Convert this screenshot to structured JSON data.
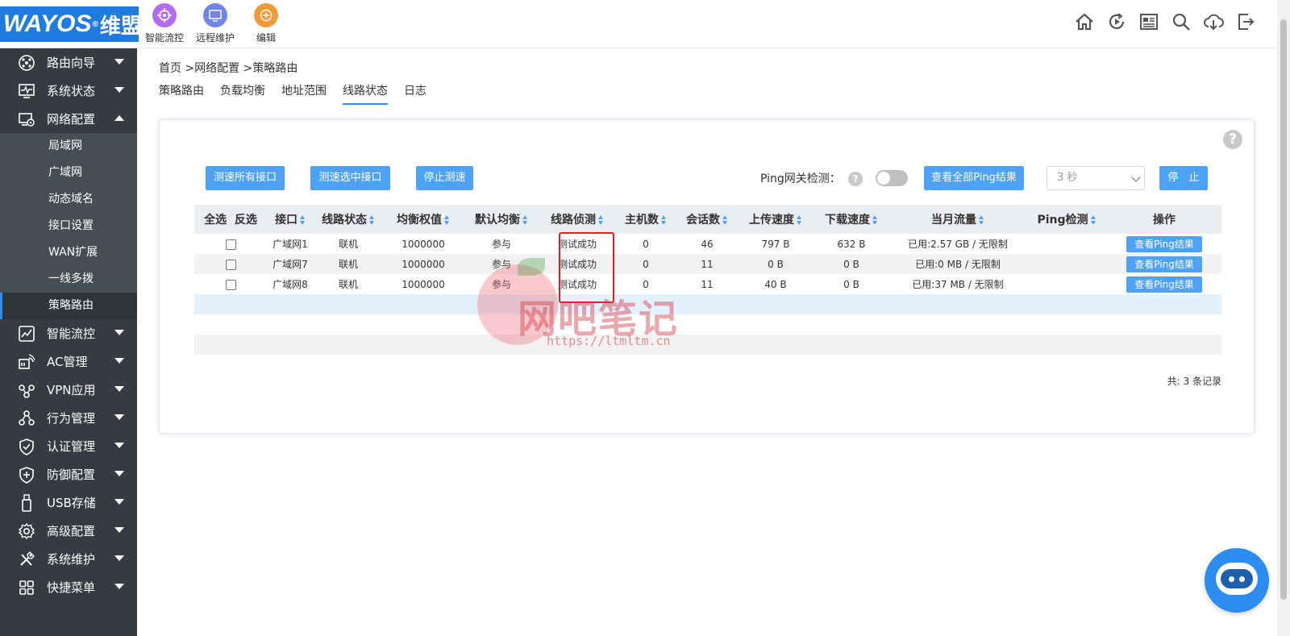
{
  "header": {
    "logo_text": "WAYOS",
    "logo_reg": "®",
    "logo_cn": "维盟",
    "quick_items": [
      {
        "label": "智能流控",
        "color": "#b46bf0",
        "icon": "target-icon"
      },
      {
        "label": "远程维护",
        "color": "#6f86e8",
        "icon": "monitor-icon"
      },
      {
        "label": "编辑",
        "color": "#f29a3a",
        "icon": "plus-circle-icon"
      }
    ],
    "toolbar_icons": [
      "home-icon",
      "refresh-play-icon",
      "news-icon",
      "search-icon",
      "cloud-download-icon",
      "logout-icon"
    ]
  },
  "sidebar": {
    "items": [
      {
        "label": "路由向导",
        "icon": "wizard-icon"
      },
      {
        "label": "系统状态",
        "icon": "monitor-pulse-icon"
      },
      {
        "label": "网络配置",
        "icon": "network-config-icon",
        "expanded": true
      },
      {
        "label": "智能流控",
        "icon": "chart-icon"
      },
      {
        "label": "AC管理",
        "icon": "wifi-icon"
      },
      {
        "label": "VPN应用",
        "icon": "vpn-icon"
      },
      {
        "label": "行为管理",
        "icon": "behavior-icon"
      },
      {
        "label": "认证管理",
        "icon": "shield-check-icon"
      },
      {
        "label": "防御配置",
        "icon": "shield-plus-icon"
      },
      {
        "label": "USB存储",
        "icon": "usb-icon"
      },
      {
        "label": "高级配置",
        "icon": "gear-icon"
      },
      {
        "label": "系统维护",
        "icon": "tools-icon"
      },
      {
        "label": "快捷菜单",
        "icon": "grid-icon"
      }
    ],
    "subitems": [
      "局域网",
      "广域网",
      "动态域名",
      "接口设置",
      "WAN扩展",
      "一线多拨",
      "策略路由"
    ],
    "active_subitem": "策略路由"
  },
  "breadcrumb": "首页 >网络配置 >策略路由",
  "tabs": [
    {
      "label": "策略路由"
    },
    {
      "label": "负载均衡"
    },
    {
      "label": "地址范围"
    },
    {
      "label": "线路状态",
      "active": true
    },
    {
      "label": "日志"
    }
  ],
  "toolbar": {
    "speed_all": "测速所有接口",
    "speed_selected": "测速选中接口",
    "stop_speed": "停止测速",
    "ping_label": "Ping网关检测：",
    "ping_toggle_on": false,
    "view_all_ping": "查看全部Ping结果",
    "interval_value": "3 秒",
    "stop": "停　止"
  },
  "table": {
    "headers": {
      "select_all": "全选",
      "invert": "反选",
      "cols": [
        "接口",
        "线路状态",
        "均衡权值",
        "默认均衡",
        "线路侦测",
        "主机数",
        "会话数",
        "上传速度",
        "下载速度",
        "当月流量",
        "Ping检测",
        "操作"
      ]
    },
    "rows": [
      {
        "iface": "广域网1",
        "status": "联机",
        "weight": "1000000",
        "balance": "参与",
        "detect": "测试成功",
        "hosts": "0",
        "sessions": "46",
        "up": "797 B",
        "down": "632 B",
        "traffic": "已用:2.57 GB / 无限制",
        "ping": "",
        "action": "查看Ping结果"
      },
      {
        "iface": "广域网7",
        "status": "联机",
        "weight": "1000000",
        "balance": "参与",
        "detect": "测试成功",
        "hosts": "0",
        "sessions": "11",
        "up": "0 B",
        "down": "0 B",
        "traffic": "已用:0 MB / 无限制",
        "ping": "",
        "action": "查看Ping结果"
      },
      {
        "iface": "广域网8",
        "status": "联机",
        "weight": "1000000",
        "balance": "参与",
        "detect": "测试成功",
        "hosts": "0",
        "sessions": "11",
        "up": "40 B",
        "down": "0 B",
        "traffic": "已用:37 MB / 无限制",
        "ping": "",
        "action": "查看Ping结果"
      }
    ],
    "total": "共: 3 条记录"
  },
  "watermark": {
    "text": "网吧笔记",
    "url": "https://ltmltm.cn"
  },
  "colors": {
    "accent": "#2d8cf0",
    "button": "#4ea2f5",
    "sidebar": "#353b40",
    "highlight_box": "#e02020"
  }
}
